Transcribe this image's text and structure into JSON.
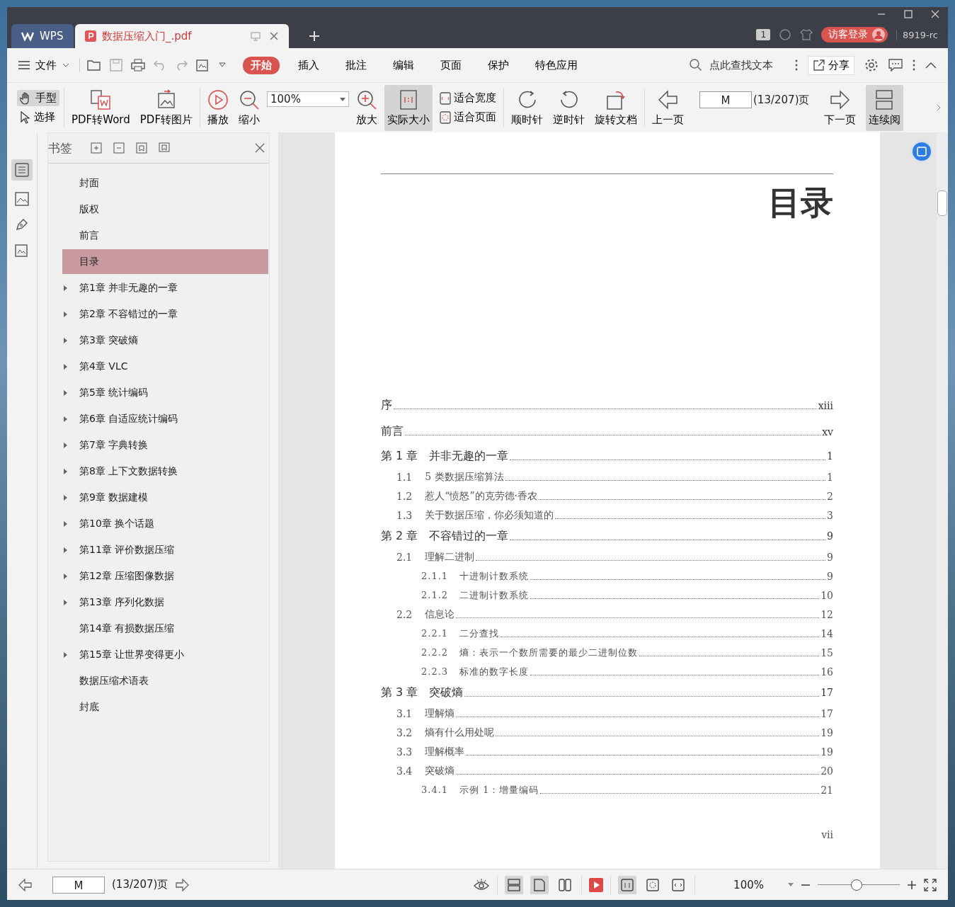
{
  "tabs": [
    {
      "label": "WPS",
      "kind": "home",
      "selected": false
    },
    {
      "label": "数据压缩入门_.pdf",
      "kind": "doc",
      "selected": true
    }
  ],
  "title_bar": {
    "page_badge": "1",
    "login_button": "访客登录",
    "user": "8919-rc"
  },
  "menu": {
    "file": "文件",
    "tabs": [
      {
        "label": "开始",
        "selected": true
      },
      {
        "label": "插入",
        "selected": false
      },
      {
        "label": "批注",
        "selected": false
      },
      {
        "label": "编辑",
        "selected": false
      },
      {
        "label": "页面",
        "selected": false
      },
      {
        "label": "保护",
        "selected": false
      },
      {
        "label": "特色应用",
        "selected": false
      }
    ],
    "search_placeholder": "点此查找文本",
    "share": "分享"
  },
  "toolbar": {
    "hand": {
      "label": "手型",
      "selected": true
    },
    "select": {
      "label": "选择",
      "selected": false
    },
    "pdf_to_word": "PDF转Word",
    "pdf_to_image": "PDF转图片",
    "play": "播放",
    "zoom_out": "缩小",
    "zoom_value": "100%",
    "zoom_in": "放大",
    "actual_size": {
      "label": "实际大小",
      "selected": true
    },
    "fit_width": "适合宽度",
    "fit_page": "适合页面",
    "clockwise": "顺时针",
    "counterclockwise": "逆时针",
    "rotate_doc": "旋转文档",
    "prev_page": "上一页",
    "page_value": "M",
    "page_count": "(13/207)页",
    "next_page": "下一页",
    "continuous": {
      "label": "连续阅",
      "selected": true
    }
  },
  "sidebar": {
    "title": "书签",
    "items": [
      {
        "label": "封面",
        "kind": "leaf",
        "selected": false
      },
      {
        "label": "版权",
        "kind": "leaf",
        "selected": false
      },
      {
        "label": "前言",
        "kind": "leaf",
        "selected": false
      },
      {
        "label": "目录",
        "kind": "leaf",
        "selected": true
      },
      {
        "label": "第1章 并非无趣的一章",
        "kind": "branch",
        "selected": false
      },
      {
        "label": "第2章 不容错过的一章",
        "kind": "branch",
        "selected": false
      },
      {
        "label": "第3章 突破熵",
        "kind": "branch",
        "selected": false
      },
      {
        "label": "第4章 VLC",
        "kind": "branch",
        "selected": false
      },
      {
        "label": "第5章 统计编码",
        "kind": "branch",
        "selected": false
      },
      {
        "label": "第6章 自适应统计编码",
        "kind": "branch",
        "selected": false
      },
      {
        "label": "第7章 字典转换",
        "kind": "branch",
        "selected": false
      },
      {
        "label": "第8章 上下文数据转换",
        "kind": "branch",
        "selected": false
      },
      {
        "label": "第9章 数据建模",
        "kind": "branch",
        "selected": false
      },
      {
        "label": "第10章 换个话题",
        "kind": "branch",
        "selected": false
      },
      {
        "label": "第11章 评价数据压缩",
        "kind": "branch",
        "selected": false
      },
      {
        "label": "第12章 压缩图像数据",
        "kind": "branch",
        "selected": false
      },
      {
        "label": "第13章 序列化数据",
        "kind": "branch",
        "selected": false
      },
      {
        "label": "第14章 有损数据压缩",
        "kind": "leaf",
        "selected": false
      },
      {
        "label": "第15章 让世界变得更小",
        "kind": "branch",
        "selected": false
      },
      {
        "label": "数据压缩术语表",
        "kind": "leaf",
        "selected": false
      },
      {
        "label": "封底",
        "kind": "leaf",
        "selected": false
      }
    ]
  },
  "document": {
    "heading": "目录",
    "toc": [
      {
        "kind": "part",
        "title": "序",
        "page": "xiii"
      },
      {
        "kind": "part",
        "title": "前言",
        "page": "xv"
      },
      {
        "kind": "chapter",
        "num": "第 1 章",
        "title": "并非无趣的一章",
        "page": "1"
      },
      {
        "kind": "section",
        "num": "1.1",
        "title": "5 类数据压缩算法",
        "page": "1"
      },
      {
        "kind": "section",
        "num": "1.2",
        "title": "惹人“愤怒”的克劳德·香农",
        "page": "2"
      },
      {
        "kind": "section",
        "num": "1.3",
        "title": "关于数据压缩，你必须知道的",
        "page": "3"
      },
      {
        "kind": "chapter",
        "num": "第 2 章",
        "title": "不容错过的一章",
        "page": "9"
      },
      {
        "kind": "section",
        "num": "2.1",
        "title": "理解二进制",
        "page": "9"
      },
      {
        "kind": "subsection",
        "num": "2.1.1",
        "title": "十进制计数系统",
        "page": "9"
      },
      {
        "kind": "subsection",
        "num": "2.1.2",
        "title": "二进制计数系统",
        "page": "10"
      },
      {
        "kind": "section",
        "num": "2.2",
        "title": "信息论",
        "page": "12"
      },
      {
        "kind": "subsection",
        "num": "2.2.1",
        "title": "二分查找",
        "page": "14"
      },
      {
        "kind": "subsection",
        "num": "2.2.2",
        "title": "熵：表示一个数所需要的最少二进制位数",
        "page": "15"
      },
      {
        "kind": "subsection",
        "num": "2.2.3",
        "title": "标准的数字长度",
        "page": "16"
      },
      {
        "kind": "chapter",
        "num": "第 3 章",
        "title": "突破熵",
        "page": "17"
      },
      {
        "kind": "section",
        "num": "3.1",
        "title": "理解熵",
        "page": "17"
      },
      {
        "kind": "section",
        "num": "3.2",
        "title": "熵有什么用处呢",
        "page": "19"
      },
      {
        "kind": "section",
        "num": "3.3",
        "title": "理解概率",
        "page": "19"
      },
      {
        "kind": "section",
        "num": "3.4",
        "title": "突破熵",
        "page": "20"
      },
      {
        "kind": "subsection",
        "num": "3.4.1",
        "title": "示例 1：增量编码",
        "page": "21"
      }
    ],
    "page_number": "vii"
  },
  "status_bar": {
    "page_value": "M",
    "page_count": "(13/207)页",
    "view_modes": [
      {
        "selected": true
      },
      {
        "selected": true
      },
      {
        "selected": false
      }
    ],
    "fit_modes": [
      {
        "selected": true
      },
      {
        "selected": false
      },
      {
        "selected": false
      }
    ],
    "zoom": "100%",
    "zoom_slider": {
      "level": 0.47
    }
  }
}
